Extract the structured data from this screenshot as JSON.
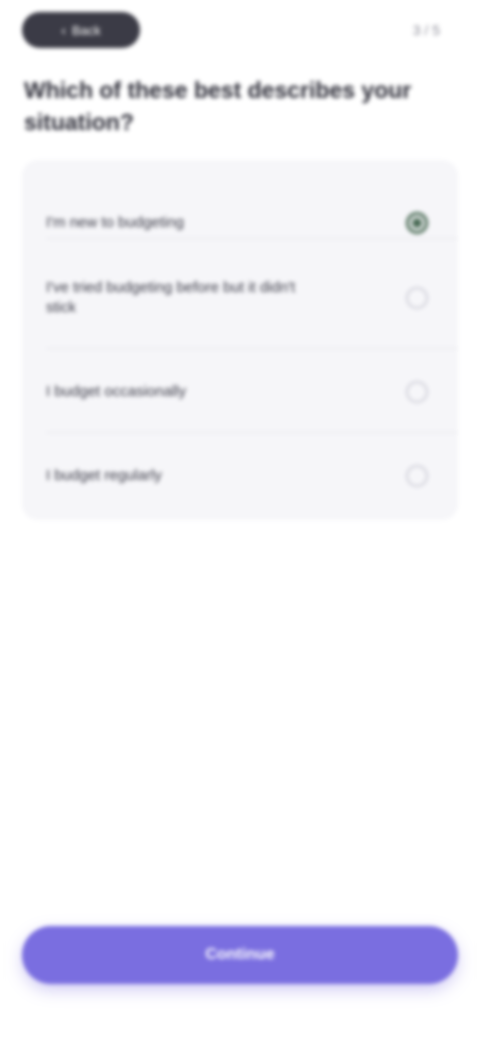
{
  "header": {
    "back_label": "Back",
    "step_counter": "3 / 5"
  },
  "question": {
    "text": "Which of these best describes your situation?"
  },
  "options": [
    {
      "label": "I'm new to budgeting",
      "selected": true
    },
    {
      "label": "I've tried budgeting before but it didn't stick",
      "selected": false
    },
    {
      "label": "I budget occasionally",
      "selected": false
    },
    {
      "label": "I budget regularly",
      "selected": false
    }
  ],
  "footer": {
    "continue_label": "Continue"
  },
  "colors": {
    "accent": "#7a6ee0",
    "selected_radio": "#4a6b55",
    "card_background": "#f6f6f9"
  }
}
